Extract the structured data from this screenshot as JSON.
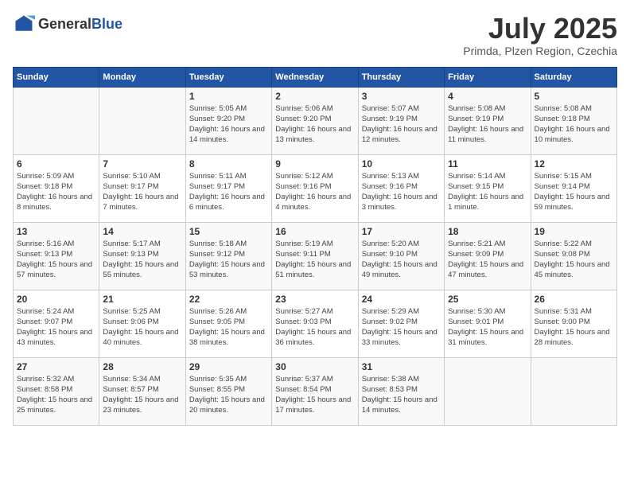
{
  "header": {
    "logo_general": "General",
    "logo_blue": "Blue",
    "month_title": "July 2025",
    "subtitle": "Primda, Plzen Region, Czechia"
  },
  "weekdays": [
    "Sunday",
    "Monday",
    "Tuesday",
    "Wednesday",
    "Thursday",
    "Friday",
    "Saturday"
  ],
  "weeks": [
    [
      {
        "day": "",
        "info": ""
      },
      {
        "day": "",
        "info": ""
      },
      {
        "day": "1",
        "info": "Sunrise: 5:05 AM\nSunset: 9:20 PM\nDaylight: 16 hours and 14 minutes."
      },
      {
        "day": "2",
        "info": "Sunrise: 5:06 AM\nSunset: 9:20 PM\nDaylight: 16 hours and 13 minutes."
      },
      {
        "day": "3",
        "info": "Sunrise: 5:07 AM\nSunset: 9:19 PM\nDaylight: 16 hours and 12 minutes."
      },
      {
        "day": "4",
        "info": "Sunrise: 5:08 AM\nSunset: 9:19 PM\nDaylight: 16 hours and 11 minutes."
      },
      {
        "day": "5",
        "info": "Sunrise: 5:08 AM\nSunset: 9:18 PM\nDaylight: 16 hours and 10 minutes."
      }
    ],
    [
      {
        "day": "6",
        "info": "Sunrise: 5:09 AM\nSunset: 9:18 PM\nDaylight: 16 hours and 8 minutes."
      },
      {
        "day": "7",
        "info": "Sunrise: 5:10 AM\nSunset: 9:17 PM\nDaylight: 16 hours and 7 minutes."
      },
      {
        "day": "8",
        "info": "Sunrise: 5:11 AM\nSunset: 9:17 PM\nDaylight: 16 hours and 6 minutes."
      },
      {
        "day": "9",
        "info": "Sunrise: 5:12 AM\nSunset: 9:16 PM\nDaylight: 16 hours and 4 minutes."
      },
      {
        "day": "10",
        "info": "Sunrise: 5:13 AM\nSunset: 9:16 PM\nDaylight: 16 hours and 3 minutes."
      },
      {
        "day": "11",
        "info": "Sunrise: 5:14 AM\nSunset: 9:15 PM\nDaylight: 16 hours and 1 minute."
      },
      {
        "day": "12",
        "info": "Sunrise: 5:15 AM\nSunset: 9:14 PM\nDaylight: 15 hours and 59 minutes."
      }
    ],
    [
      {
        "day": "13",
        "info": "Sunrise: 5:16 AM\nSunset: 9:13 PM\nDaylight: 15 hours and 57 minutes."
      },
      {
        "day": "14",
        "info": "Sunrise: 5:17 AM\nSunset: 9:13 PM\nDaylight: 15 hours and 55 minutes."
      },
      {
        "day": "15",
        "info": "Sunrise: 5:18 AM\nSunset: 9:12 PM\nDaylight: 15 hours and 53 minutes."
      },
      {
        "day": "16",
        "info": "Sunrise: 5:19 AM\nSunset: 9:11 PM\nDaylight: 15 hours and 51 minutes."
      },
      {
        "day": "17",
        "info": "Sunrise: 5:20 AM\nSunset: 9:10 PM\nDaylight: 15 hours and 49 minutes."
      },
      {
        "day": "18",
        "info": "Sunrise: 5:21 AM\nSunset: 9:09 PM\nDaylight: 15 hours and 47 minutes."
      },
      {
        "day": "19",
        "info": "Sunrise: 5:22 AM\nSunset: 9:08 PM\nDaylight: 15 hours and 45 minutes."
      }
    ],
    [
      {
        "day": "20",
        "info": "Sunrise: 5:24 AM\nSunset: 9:07 PM\nDaylight: 15 hours and 43 minutes."
      },
      {
        "day": "21",
        "info": "Sunrise: 5:25 AM\nSunset: 9:06 PM\nDaylight: 15 hours and 40 minutes."
      },
      {
        "day": "22",
        "info": "Sunrise: 5:26 AM\nSunset: 9:05 PM\nDaylight: 15 hours and 38 minutes."
      },
      {
        "day": "23",
        "info": "Sunrise: 5:27 AM\nSunset: 9:03 PM\nDaylight: 15 hours and 36 minutes."
      },
      {
        "day": "24",
        "info": "Sunrise: 5:29 AM\nSunset: 9:02 PM\nDaylight: 15 hours and 33 minutes."
      },
      {
        "day": "25",
        "info": "Sunrise: 5:30 AM\nSunset: 9:01 PM\nDaylight: 15 hours and 31 minutes."
      },
      {
        "day": "26",
        "info": "Sunrise: 5:31 AM\nSunset: 9:00 PM\nDaylight: 15 hours and 28 minutes."
      }
    ],
    [
      {
        "day": "27",
        "info": "Sunrise: 5:32 AM\nSunset: 8:58 PM\nDaylight: 15 hours and 25 minutes."
      },
      {
        "day": "28",
        "info": "Sunrise: 5:34 AM\nSunset: 8:57 PM\nDaylight: 15 hours and 23 minutes."
      },
      {
        "day": "29",
        "info": "Sunrise: 5:35 AM\nSunset: 8:55 PM\nDaylight: 15 hours and 20 minutes."
      },
      {
        "day": "30",
        "info": "Sunrise: 5:37 AM\nSunset: 8:54 PM\nDaylight: 15 hours and 17 minutes."
      },
      {
        "day": "31",
        "info": "Sunrise: 5:38 AM\nSunset: 8:53 PM\nDaylight: 15 hours and 14 minutes."
      },
      {
        "day": "",
        "info": ""
      },
      {
        "day": "",
        "info": ""
      }
    ]
  ]
}
